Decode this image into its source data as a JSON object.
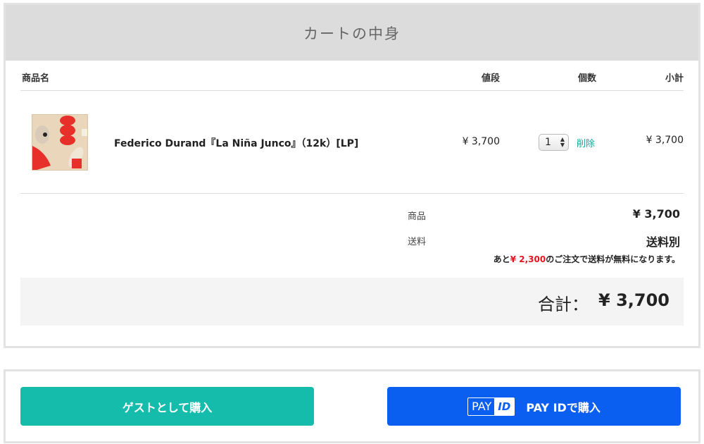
{
  "cart": {
    "title": "カートの中身",
    "columns": {
      "name": "商品名",
      "price": "値段",
      "quantity": "個数",
      "subtotal": "小計"
    },
    "items": [
      {
        "name": "Federico Durand『La Niña Junco』（12k）[LP]",
        "price": "¥ 3,700",
        "quantity": "1",
        "remove_label": "削除",
        "subtotal": "¥ 3,700"
      }
    ],
    "summary": {
      "goods_label": "商品",
      "goods_value": "¥ 3,700",
      "shipping_label": "送料",
      "shipping_value": "送料別",
      "free_shipping_prefix": "あと",
      "free_shipping_amount": "¥ 2,300",
      "free_shipping_suffix": "のご注文で送料が無料になります。"
    },
    "total": {
      "label": "合計：",
      "value": "¥ 3,700"
    }
  },
  "actions": {
    "guest_label": "ゲストとして購入",
    "payid_logo_pay": "PAY",
    "payid_logo_id": "ID",
    "payid_label": "PAY IDで購入"
  },
  "colors": {
    "header_bg": "#dcdcdc",
    "guest_button": "#15bcab",
    "payid_button": "#0a5ef0",
    "remove_link": "#13a59a",
    "highlight_amount": "#e5131f"
  }
}
